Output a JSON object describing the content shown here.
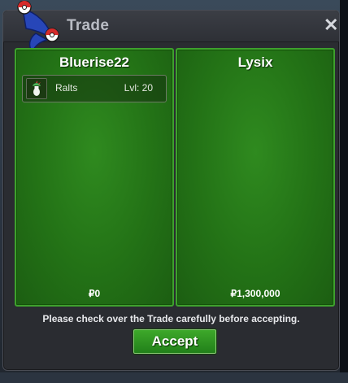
{
  "window": {
    "title": "Trade",
    "close_icon": "close-icon",
    "logo_icon": "pokeball-logo-icon"
  },
  "trade": {
    "left": {
      "player_name": "Bluerise22",
      "pokemon": [
        {
          "name": "Ralts",
          "level": "Lvl: 20",
          "icon": "ralts-sprite-icon"
        }
      ],
      "money": "₽0"
    },
    "right": {
      "player_name": "Lysix",
      "pokemon": [],
      "money": "₽1,300,000"
    }
  },
  "notice": "Please check over the Trade carefully before accepting.",
  "accept_label": "Accept",
  "colors": {
    "panel_green": "#237216",
    "panel_border": "#3ea12d",
    "window_bg": "#2a2c31",
    "accept_green": "#2e9421"
  }
}
